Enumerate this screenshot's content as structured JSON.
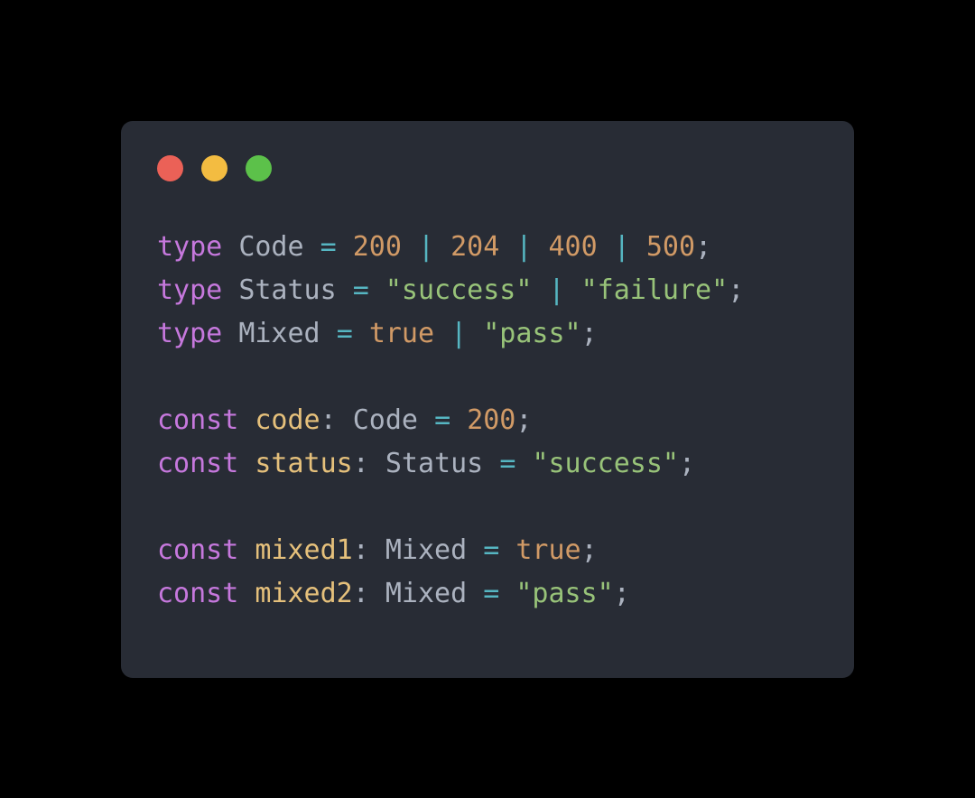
{
  "window": {
    "traffic_lights": [
      {
        "name": "close",
        "color": "#eb6157"
      },
      {
        "name": "minimize",
        "color": "#f3bc41"
      },
      {
        "name": "maximize",
        "color": "#5cc14a"
      }
    ]
  },
  "theme": {
    "page_background": "#000000",
    "card_background": "#282c35",
    "keyword": "#c678dd",
    "type_name": "#abb2bf",
    "variable": "#e5c07b",
    "operator": "#56b6c2",
    "number": "#d19a66",
    "boolean": "#d19a66",
    "string": "#98c379",
    "punctuation": "#abb2bf"
  },
  "code": {
    "language": "typescript",
    "lines": [
      {
        "tokens": [
          {
            "text": "type",
            "kind": "keyword"
          },
          {
            "text": " ",
            "kind": "plain"
          },
          {
            "text": "Code",
            "kind": "type"
          },
          {
            "text": " ",
            "kind": "plain"
          },
          {
            "text": "=",
            "kind": "operator"
          },
          {
            "text": " ",
            "kind": "plain"
          },
          {
            "text": "200",
            "kind": "number"
          },
          {
            "text": " ",
            "kind": "plain"
          },
          {
            "text": "|",
            "kind": "operator"
          },
          {
            "text": " ",
            "kind": "plain"
          },
          {
            "text": "204",
            "kind": "number"
          },
          {
            "text": " ",
            "kind": "plain"
          },
          {
            "text": "|",
            "kind": "operator"
          },
          {
            "text": " ",
            "kind": "plain"
          },
          {
            "text": "400",
            "kind": "number"
          },
          {
            "text": " ",
            "kind": "plain"
          },
          {
            "text": "|",
            "kind": "operator"
          },
          {
            "text": " ",
            "kind": "plain"
          },
          {
            "text": "500",
            "kind": "number"
          },
          {
            "text": ";",
            "kind": "punct"
          }
        ]
      },
      {
        "tokens": [
          {
            "text": "type",
            "kind": "keyword"
          },
          {
            "text": " ",
            "kind": "plain"
          },
          {
            "text": "Status",
            "kind": "type"
          },
          {
            "text": " ",
            "kind": "plain"
          },
          {
            "text": "=",
            "kind": "operator"
          },
          {
            "text": " ",
            "kind": "plain"
          },
          {
            "text": "\"success\"",
            "kind": "string"
          },
          {
            "text": " ",
            "kind": "plain"
          },
          {
            "text": "|",
            "kind": "operator"
          },
          {
            "text": " ",
            "kind": "plain"
          },
          {
            "text": "\"failure\"",
            "kind": "string"
          },
          {
            "text": ";",
            "kind": "punct"
          }
        ]
      },
      {
        "tokens": [
          {
            "text": "type",
            "kind": "keyword"
          },
          {
            "text": " ",
            "kind": "plain"
          },
          {
            "text": "Mixed",
            "kind": "type"
          },
          {
            "text": " ",
            "kind": "plain"
          },
          {
            "text": "=",
            "kind": "operator"
          },
          {
            "text": " ",
            "kind": "plain"
          },
          {
            "text": "true",
            "kind": "boolean"
          },
          {
            "text": " ",
            "kind": "plain"
          },
          {
            "text": "|",
            "kind": "operator"
          },
          {
            "text": " ",
            "kind": "plain"
          },
          {
            "text": "\"pass\"",
            "kind": "string"
          },
          {
            "text": ";",
            "kind": "punct"
          }
        ]
      },
      {
        "tokens": []
      },
      {
        "tokens": [
          {
            "text": "const",
            "kind": "keyword"
          },
          {
            "text": " ",
            "kind": "plain"
          },
          {
            "text": "code",
            "kind": "var"
          },
          {
            "text": ":",
            "kind": "punct"
          },
          {
            "text": " ",
            "kind": "plain"
          },
          {
            "text": "Code",
            "kind": "type"
          },
          {
            "text": " ",
            "kind": "plain"
          },
          {
            "text": "=",
            "kind": "operator"
          },
          {
            "text": " ",
            "kind": "plain"
          },
          {
            "text": "200",
            "kind": "number"
          },
          {
            "text": ";",
            "kind": "punct"
          }
        ]
      },
      {
        "tokens": [
          {
            "text": "const",
            "kind": "keyword"
          },
          {
            "text": " ",
            "kind": "plain"
          },
          {
            "text": "status",
            "kind": "var"
          },
          {
            "text": ":",
            "kind": "punct"
          },
          {
            "text": " ",
            "kind": "plain"
          },
          {
            "text": "Status",
            "kind": "type"
          },
          {
            "text": " ",
            "kind": "plain"
          },
          {
            "text": "=",
            "kind": "operator"
          },
          {
            "text": " ",
            "kind": "plain"
          },
          {
            "text": "\"success\"",
            "kind": "string"
          },
          {
            "text": ";",
            "kind": "punct"
          }
        ]
      },
      {
        "tokens": []
      },
      {
        "tokens": [
          {
            "text": "const",
            "kind": "keyword"
          },
          {
            "text": " ",
            "kind": "plain"
          },
          {
            "text": "mixed1",
            "kind": "var"
          },
          {
            "text": ":",
            "kind": "punct"
          },
          {
            "text": " ",
            "kind": "plain"
          },
          {
            "text": "Mixed",
            "kind": "type"
          },
          {
            "text": " ",
            "kind": "plain"
          },
          {
            "text": "=",
            "kind": "operator"
          },
          {
            "text": " ",
            "kind": "plain"
          },
          {
            "text": "true",
            "kind": "boolean"
          },
          {
            "text": ";",
            "kind": "punct"
          }
        ]
      },
      {
        "tokens": [
          {
            "text": "const",
            "kind": "keyword"
          },
          {
            "text": " ",
            "kind": "plain"
          },
          {
            "text": "mixed2",
            "kind": "var"
          },
          {
            "text": ":",
            "kind": "punct"
          },
          {
            "text": " ",
            "kind": "plain"
          },
          {
            "text": "Mixed",
            "kind": "type"
          },
          {
            "text": " ",
            "kind": "plain"
          },
          {
            "text": "=",
            "kind": "operator"
          },
          {
            "text": " ",
            "kind": "plain"
          },
          {
            "text": "\"pass\"",
            "kind": "string"
          },
          {
            "text": ";",
            "kind": "punct"
          }
        ]
      }
    ]
  }
}
